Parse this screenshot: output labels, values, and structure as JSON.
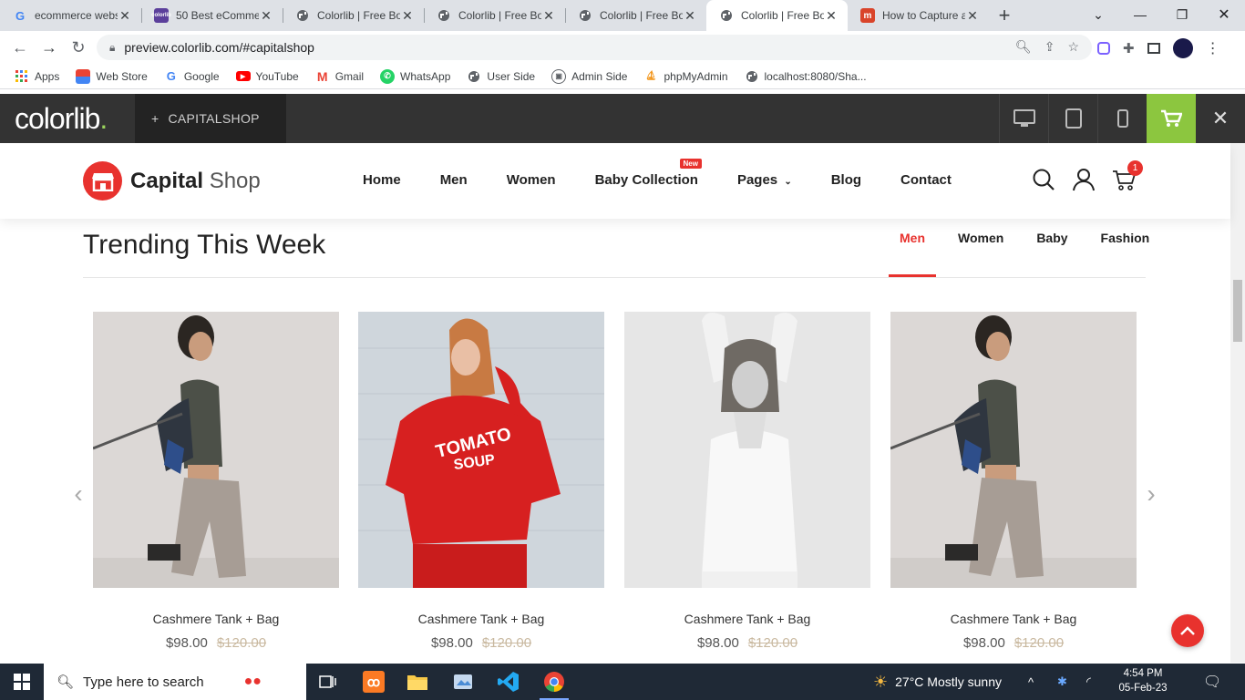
{
  "browser": {
    "tabs": [
      {
        "label": "ecommerce webs",
        "favicon": "G",
        "fav_color": "#4285f4",
        "active": false
      },
      {
        "label": "50 Best eComme",
        "favicon": "c",
        "fav_color": "#5b3f9b",
        "active": false
      },
      {
        "label": "Colorlib | Free Bo",
        "favicon": "globe",
        "fav_color": "#5f6368",
        "active": false
      },
      {
        "label": "Colorlib | Free Bo",
        "favicon": "globe",
        "fav_color": "#5f6368",
        "active": false
      },
      {
        "label": "Colorlib | Free Bo",
        "favicon": "globe",
        "fav_color": "#5f6368",
        "active": false
      },
      {
        "label": "Colorlib | Free Bo",
        "favicon": "globe",
        "fav_color": "#5f6368",
        "active": true
      },
      {
        "label": "How to Capture a",
        "favicon": "m",
        "fav_color": "#d9442a",
        "active": false
      }
    ],
    "url": "preview.colorlib.com/#capitalshop",
    "bookmarks": [
      {
        "label": "Apps",
        "icon": "apps-grid-icon"
      },
      {
        "label": "Web Store",
        "icon": "web-store-icon"
      },
      {
        "label": "Google",
        "icon": "google-icon"
      },
      {
        "label": "YouTube",
        "icon": "youtube-icon"
      },
      {
        "label": "Gmail",
        "icon": "gmail-icon"
      },
      {
        "label": "WhatsApp",
        "icon": "whatsapp-icon"
      },
      {
        "label": "User Side",
        "icon": "globe-icon"
      },
      {
        "label": "Admin Side",
        "icon": "admin-icon"
      },
      {
        "label": "phpMyAdmin",
        "icon": "phpmyadmin-icon"
      },
      {
        "label": "localhost:8080/Sha...",
        "icon": "globe-icon"
      }
    ]
  },
  "colorlib": {
    "logo": "colorlib",
    "logo_dot": ".",
    "theme_label": "CAPITALSHOP",
    "accent": "#8cc63f"
  },
  "site": {
    "brand_bold": "Capital",
    "brand_light": "Shop",
    "nav": [
      {
        "label": "Home"
      },
      {
        "label": "Men"
      },
      {
        "label": "Women"
      },
      {
        "label": "Baby Collection",
        "badge": "New"
      },
      {
        "label": "Pages",
        "dropdown": true
      },
      {
        "label": "Blog"
      },
      {
        "label": "Contact"
      }
    ],
    "cart_count": "1",
    "accent": "#e8322e"
  },
  "trending": {
    "title": "Trending This Week",
    "tabs": [
      "Men",
      "Women",
      "Baby",
      "Fashion"
    ],
    "active_tab": "Men",
    "products": [
      {
        "name": "Cashmere Tank + Bag",
        "price": "$98.00",
        "old_price": "$120.00"
      },
      {
        "name": "Cashmere Tank + Bag",
        "price": "$98.00",
        "old_price": "$120.00"
      },
      {
        "name": "Cashmere Tank + Bag",
        "price": "$98.00",
        "old_price": "$120.00"
      },
      {
        "name": "Cashmere Tank + Bag",
        "price": "$98.00",
        "old_price": "$120.00"
      }
    ],
    "sweatshirt_text_1": "TOMATO",
    "sweatshirt_text_2": "SOUP"
  },
  "taskbar": {
    "search_placeholder": "Type here to search",
    "weather": "27°C  Mostly sunny",
    "time": "4:54 PM",
    "date": "05-Feb-23"
  }
}
